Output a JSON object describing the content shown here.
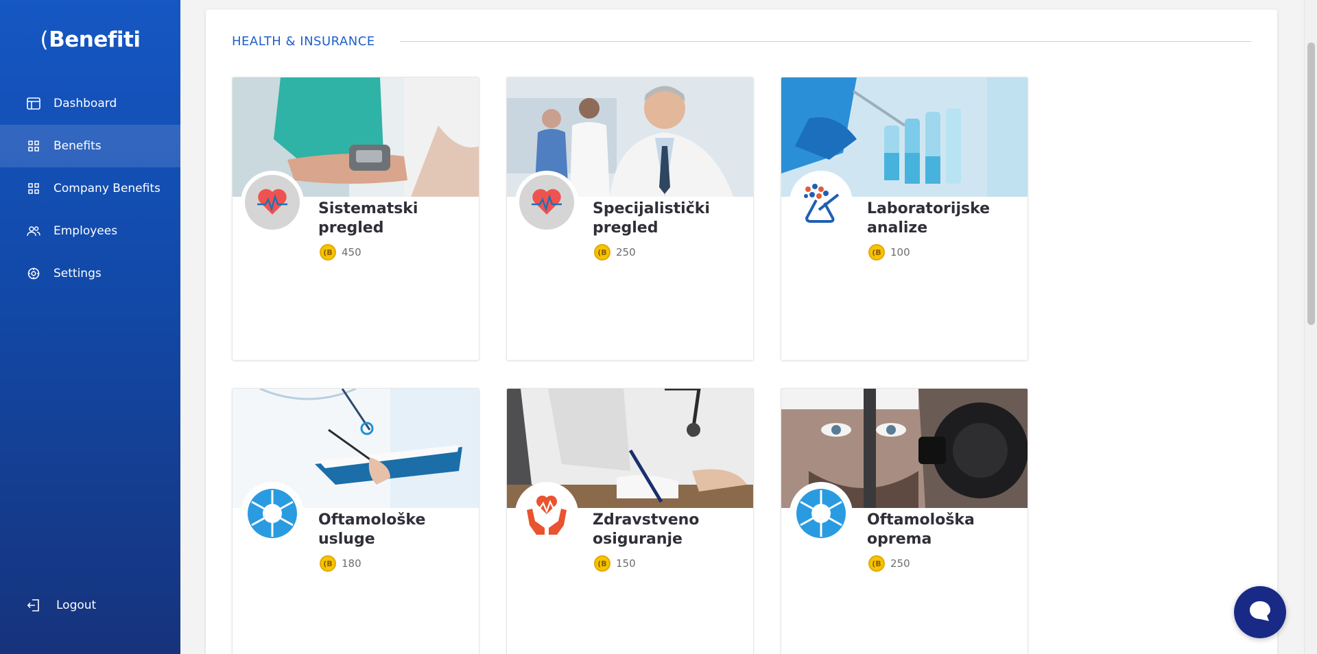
{
  "brand": {
    "logo_text": "Benefiti",
    "logo_mark": "("
  },
  "sidebar": {
    "items": [
      {
        "label": "Dashboard",
        "icon": "dashboard-icon"
      },
      {
        "label": "Benefits",
        "icon": "grid-icon",
        "active": true
      },
      {
        "label": "Company Benefits",
        "icon": "grid-icon"
      },
      {
        "label": "Employees",
        "icon": "users-icon"
      },
      {
        "label": "Settings",
        "icon": "gear-icon"
      }
    ],
    "logout_label": "Logout"
  },
  "section": {
    "title": "HEALTH & INSURANCE"
  },
  "currency_symbol": "(B",
  "cards": [
    {
      "title_line1": "Sistematski",
      "title_line2": "pregled",
      "price": "450",
      "icon": "heart-pulse-icon"
    },
    {
      "title_line1": "Specijalistički",
      "title_line2": "pregled",
      "price": "250",
      "icon": "heart-pulse-icon"
    },
    {
      "title_line1": "Laboratorijske",
      "title_line2": "analize",
      "price": "100",
      "icon": "lab-flask-icon"
    },
    {
      "title_line1": "Oftamološke",
      "title_line2": "usluge",
      "price": "180",
      "icon": "aperture-icon"
    },
    {
      "title_line1": "Zdravstveno",
      "title_line2": "osiguranje",
      "price": "150",
      "icon": "heart-hands-icon"
    },
    {
      "title_line1": "Oftamološka",
      "title_line2": "oprema",
      "price": "250",
      "icon": "aperture-icon"
    }
  ],
  "colors": {
    "sidebar_top": "#1557c3",
    "sidebar_bottom": "#16337c",
    "accent": "#1d5fc9",
    "coin": "#f6c400",
    "chat": "#182a86"
  }
}
